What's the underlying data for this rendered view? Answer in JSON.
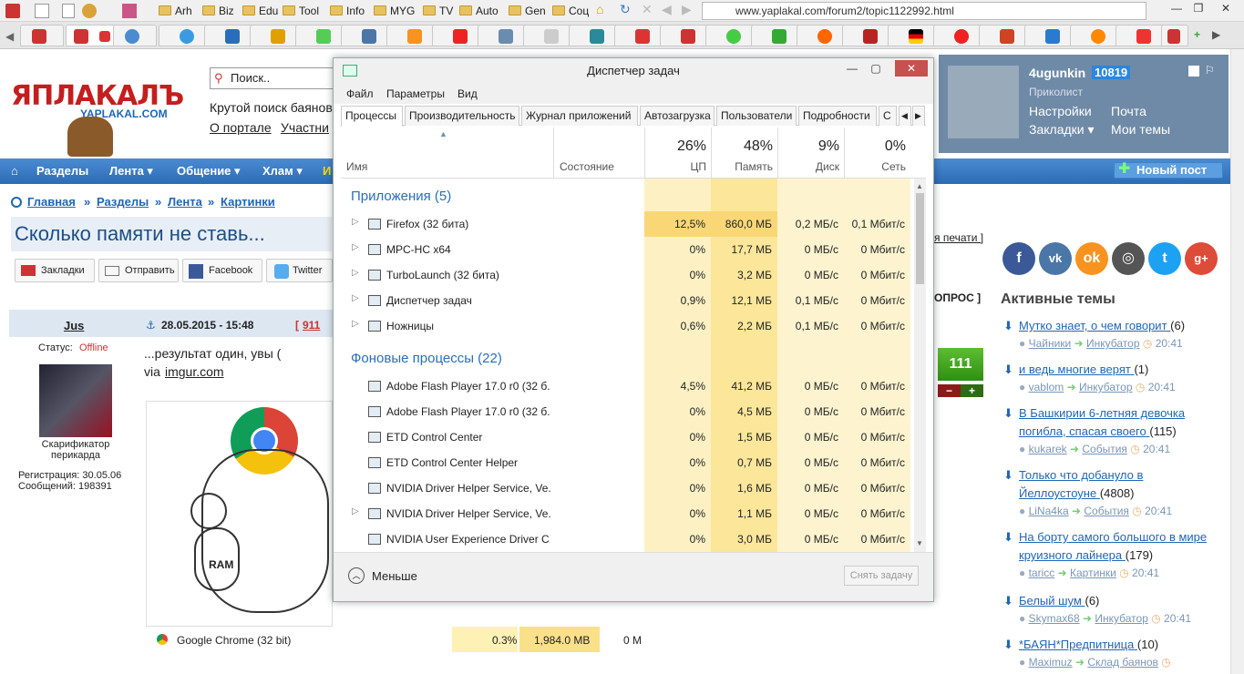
{
  "browser": {
    "bookmarks": [
      "Arh",
      "Biz",
      "Edu",
      "Tool",
      "Info",
      "MYG",
      "TV",
      "Auto",
      "Gen",
      "Соц"
    ],
    "url": "www.yaplakal.com/forum2/topic1122992.html"
  },
  "site": {
    "logo": "ЯПЛАКАЛЪ",
    "logo_sub": "YAPLAKAL.COM",
    "search_placeholder": "Поиск..",
    "tagline": "Крутой поиск баянов",
    "links": [
      "О портале",
      "Участни"
    ],
    "nav": [
      "Разделы",
      "Лента ▾",
      "Общение ▾",
      "Хлам ▾",
      "И"
    ],
    "new_post": "Новый пост",
    "breadcrumb": [
      "Главная",
      "»",
      "Разделы",
      "»",
      "Лента",
      "»",
      "Картинки"
    ]
  },
  "user_panel": {
    "name": "4ugunkin",
    "karma": "10819",
    "rank": "Приколист",
    "links": [
      "Настройки",
      "Почта",
      "Закладки ▾",
      "Мои темы"
    ]
  },
  "post": {
    "title": "Сколько памяти не ставь...",
    "share_buttons": [
      "Закладки",
      "Отправить",
      "Facebook",
      "Twitter"
    ],
    "author": "Jus",
    "date": "28.05.2015 - 15:48",
    "post_num": "911",
    "status_label": "Статус:",
    "status_value": "Offline",
    "author_title": "Скарификатор перикарда",
    "registration": "Регистрация: 30.05.06",
    "messages": "Сообщений: 198391",
    "text": "...результат один, увы (",
    "via": "via",
    "via_link": "imgur.com",
    "image_caption": "RAM",
    "chrome_row": {
      "name": "Google Chrome (32 bit)",
      "cpu": "0.3%",
      "mem": "1,984.0 MB",
      "disk": "0 M"
    },
    "print_link": "я печати ]",
    "poll_label": "ОПРОС ]",
    "rating": "111"
  },
  "task_manager": {
    "title": "Диспетчер задач",
    "menu": [
      "Файл",
      "Параметры",
      "Вид"
    ],
    "tabs": [
      "Процессы",
      "Производительность",
      "Журнал приложений",
      "Автозагрузка",
      "Пользователи",
      "Подробности",
      "С"
    ],
    "columns": {
      "name": "Имя",
      "status": "Состояние",
      "cpu": "ЦП",
      "mem": "Память",
      "disk": "Диск",
      "net": "Сеть"
    },
    "totals": {
      "cpu": "26%",
      "mem": "48%",
      "disk": "9%",
      "net": "0%"
    },
    "group_apps": "Приложения (5)",
    "group_bg": "Фоновые процессы (22)",
    "apps": [
      {
        "name": "Firefox (32 бита)",
        "cpu": "12,5%",
        "mem": "860,0 МБ",
        "disk": "0,2 МБ/с",
        "net": "0,1 Мбит/с"
      },
      {
        "name": "MPC-HC x64",
        "cpu": "0%",
        "mem": "17,7 МБ",
        "disk": "0 МБ/с",
        "net": "0 Мбит/с"
      },
      {
        "name": "TurboLaunch (32 бита)",
        "cpu": "0%",
        "mem": "3,2 МБ",
        "disk": "0 МБ/с",
        "net": "0 Мбит/с"
      },
      {
        "name": "Диспетчер задач",
        "cpu": "0,9%",
        "mem": "12,1 МБ",
        "disk": "0,1 МБ/с",
        "net": "0 Мбит/с"
      },
      {
        "name": "Ножницы",
        "cpu": "0,6%",
        "mem": "2,2 МБ",
        "disk": "0,1 МБ/с",
        "net": "0 Мбит/с"
      }
    ],
    "background": [
      {
        "name": "Adobe Flash Player 17.0 r0 (32 б...",
        "cpu": "4,5%",
        "mem": "41,2 МБ",
        "disk": "0 МБ/с",
        "net": "0 Мбит/с"
      },
      {
        "name": "Adobe Flash Player 17.0 r0 (32 б...",
        "cpu": "0%",
        "mem": "4,5 МБ",
        "disk": "0 МБ/с",
        "net": "0 Мбит/с"
      },
      {
        "name": "ETD Control Center",
        "cpu": "0%",
        "mem": "1,5 МБ",
        "disk": "0 МБ/с",
        "net": "0 Мбит/с"
      },
      {
        "name": "ETD Control Center Helper",
        "cpu": "0%",
        "mem": "0,7 МБ",
        "disk": "0 МБ/с",
        "net": "0 Мбит/с"
      },
      {
        "name": "NVIDIA Driver Helper Service, Ve...",
        "cpu": "0%",
        "mem": "1,6 МБ",
        "disk": "0 МБ/с",
        "net": "0 Мбит/с"
      },
      {
        "name": "NVIDIA Driver Helper Service, Ve...",
        "cpu": "0%",
        "mem": "1,1 МБ",
        "disk": "0 МБ/с",
        "net": "0 Мбит/с"
      },
      {
        "name": "NVIDIA User Experience Driver C...",
        "cpu": "0%",
        "mem": "3,0 МБ",
        "disk": "0 МБ/с",
        "net": "0 Мбит/с"
      }
    ],
    "less_label": "Меньше",
    "end_task": "Снять задачу"
  },
  "sidebar": {
    "title": "Активные темы",
    "topics": [
      {
        "title": "Мутко знает, о чем говорит",
        "count": "(6)",
        "user": "Чайники",
        "section": "Инкубатор",
        "time": "20:41"
      },
      {
        "title": "и ведь многие верят",
        "count": "(1)",
        "user": "vablom",
        "section": "Инкубатор",
        "time": "20:41"
      },
      {
        "title": "В Башкирии 6-летняя девочка погибла, спасая своего",
        "count": "(115)",
        "user": "kukarek",
        "section": "События",
        "time": "20:41"
      },
      {
        "title": "Только что добануло в Йеллоустоуне",
        "count": "(4808)",
        "user": "LiNa4ka",
        "section": "События",
        "time": "20:41"
      },
      {
        "title": "На борту самого большого в мире круизного лайнера",
        "count": "(179)",
        "user": "taricc",
        "section": "Картинки",
        "time": "20:41"
      },
      {
        "title": "Белый шум",
        "count": "(6)",
        "user": "Skymax68",
        "section": "Инкубатор",
        "time": "20:41"
      },
      {
        "title": "*БАЯН*Предпитница",
        "count": "(10)",
        "user": "Maximuz",
        "section": "Склад баянов",
        "time": ""
      }
    ]
  }
}
